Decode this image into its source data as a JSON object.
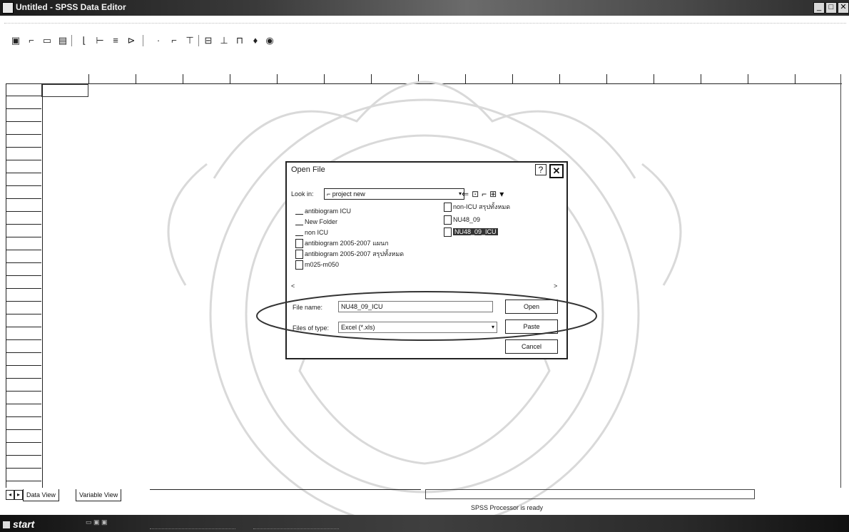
{
  "window": {
    "title": "Untitled - SPSS Data Editor"
  },
  "toolbar": {
    "icons": [
      "open-icon",
      "save-icon",
      "print-icon",
      "dialog-recall-icon",
      "undo-icon",
      "goto-chart-icon",
      "goto-case-icon",
      "variables-icon",
      "find-icon",
      "insert-cases-icon",
      "insert-variable-icon",
      "split-file-icon",
      "weight-cases-icon",
      "select-cases-icon",
      "value-labels-icon",
      "use-sets-icon"
    ]
  },
  "tabs": {
    "data_view": "Data View",
    "variable_view": "Variable View"
  },
  "status": {
    "processor": "SPSS Processor is ready"
  },
  "taskbar": {
    "start": "start"
  },
  "dialog": {
    "title": "Open File",
    "help": "?",
    "close": "✕",
    "look_in_label": "Look in:",
    "look_in_value": "project new",
    "files_col1": [
      {
        "name": "antibiogram ICU",
        "type": "folder"
      },
      {
        "name": "New Folder",
        "type": "folder"
      },
      {
        "name": "non ICU",
        "type": "folder"
      },
      {
        "name": "antibiogram 2005-2007 แผนก",
        "type": "file"
      },
      {
        "name": "antibiogram 2005-2007 สรุปทั้งหมด",
        "type": "file"
      },
      {
        "name": "m025-m050",
        "type": "file"
      }
    ],
    "files_col2": [
      {
        "name": "non-ICU สรุปทั้งหมด",
        "type": "file",
        "selected": false
      },
      {
        "name": "NU48_09",
        "type": "file",
        "selected": false
      },
      {
        "name": "NU48_09_ICU",
        "type": "file",
        "selected": true
      }
    ],
    "scroll_left": "<",
    "scroll_right": ">",
    "file_name_label": "File name:",
    "file_name_value": "NU48_09_ICU",
    "file_type_label": "Files of type:",
    "file_type_value": "Excel (*.xls)",
    "open_button": "Open",
    "paste_button": "Paste",
    "cancel_button": "Cancel"
  }
}
